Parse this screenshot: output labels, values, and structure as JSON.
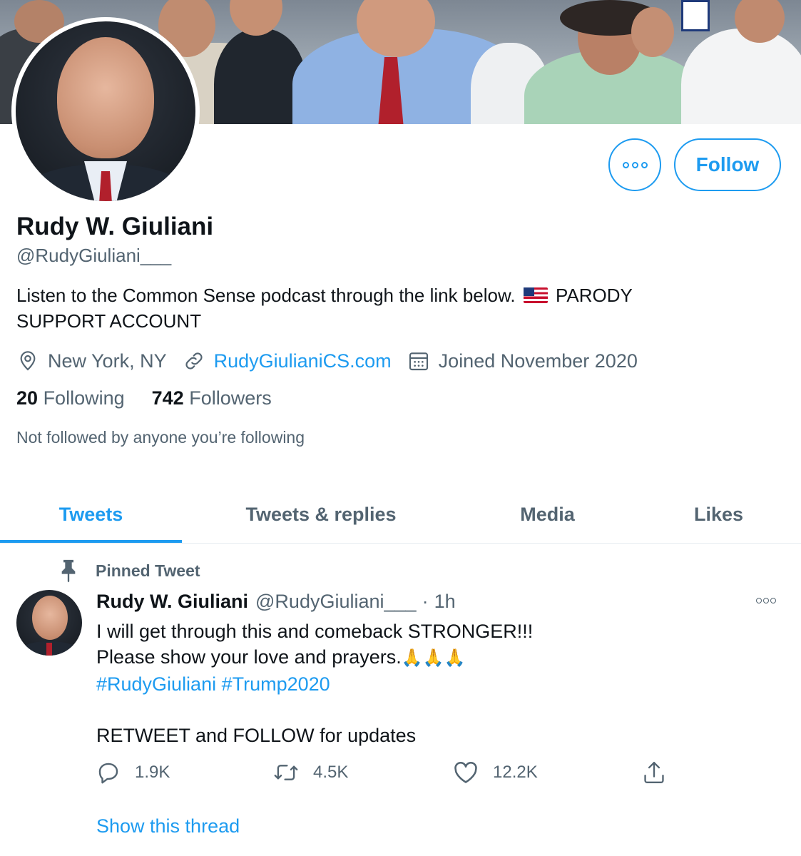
{
  "profile": {
    "name": "Rudy W. Giuliani",
    "handle": "@RudyGiuliani___",
    "bio_text": "Listen to the Common Sense podcast through the link below.",
    "bio_flag": "us-flag-icon",
    "bio_line1_end": "PARODY",
    "bio_line2": "SUPPORT ACCOUNT",
    "location": "New York, NY",
    "website": "RudyGiulianiCS.com",
    "joined": "Joined November 2020",
    "following_count": "20",
    "following_label": "Following",
    "followers_count": "742",
    "followers_label": "Followers",
    "not_followed": "Not followed by anyone you’re following"
  },
  "buttons": {
    "follow_label": "Follow",
    "more_icon": "more-options-icon"
  },
  "tabs": [
    {
      "label": "Tweets",
      "active": true
    },
    {
      "label": "Tweets & replies",
      "active": false
    },
    {
      "label": "Media",
      "active": false
    },
    {
      "label": "Likes",
      "active": false
    }
  ],
  "tweet": {
    "pinned_label": "Pinned Tweet",
    "author_name": "Rudy W. Giuliani",
    "author_handle": "@RudyGiuliani___",
    "separator": "·",
    "time": "1h",
    "line1": "I will get through this and comeback STRONGER!!!",
    "line2": "Please show your love and prayers.",
    "emoji": "🙏🙏🙏",
    "hashtags": "#RudyGiuliani #Trump2020",
    "line4": "RETWEET and FOLLOW for updates",
    "reply_count": "1.9K",
    "retweet_count": "4.5K",
    "like_count": "12.2K",
    "show_thread": "Show this thread"
  },
  "colors": {
    "accent": "#1d9bf0",
    "text_primary": "#0f1419",
    "text_secondary": "#536471"
  }
}
